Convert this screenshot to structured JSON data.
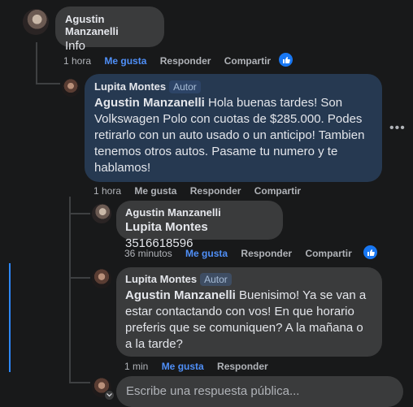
{
  "comments": [
    {
      "author": "Agustin Manzanelli",
      "text": "Info",
      "time": "1 hora",
      "like": "Me gusta",
      "reply": "Responder",
      "share": "Compartir"
    },
    {
      "author": "Lupita Montes",
      "badge": "Autor",
      "mention": "Agustin Manzanelli",
      "text": " Hola buenas tardes! Son Volkswagen Polo con cuotas de $285.000. Podes retirarlo con un auto usado o un anticipo! Tambien tenemos otros autos. Pasame tu numero y te hablamos!",
      "time": "1 hora",
      "like": "Me gusta",
      "reply": "Responder",
      "share": "Compartir",
      "more": "•••"
    },
    {
      "author": "Agustin Manzanelli",
      "mention": "Lupita Montes",
      "text": " 3516618596",
      "time": "36 minutos",
      "like": "Me gusta",
      "reply": "Responder",
      "share": "Compartir"
    },
    {
      "author": "Lupita Montes",
      "badge": "Autor",
      "mention": "Agustin Manzanelli",
      "text": " Buenisimo! Ya se van a estar contactando con vos! En que horario preferis que se comuniquen? A la mañana o a la tarde?",
      "time": "1 min",
      "like": "Me gusta",
      "reply": "Responder"
    }
  ],
  "reply_box": {
    "placeholder": "Escribe una respuesta pública..."
  },
  "colors": {
    "background": "#18191a",
    "bubble": "#3a3b3c",
    "highlight_bubble": "#263951",
    "liked": "#4f8ff7",
    "like_badge": "#1877f2"
  }
}
